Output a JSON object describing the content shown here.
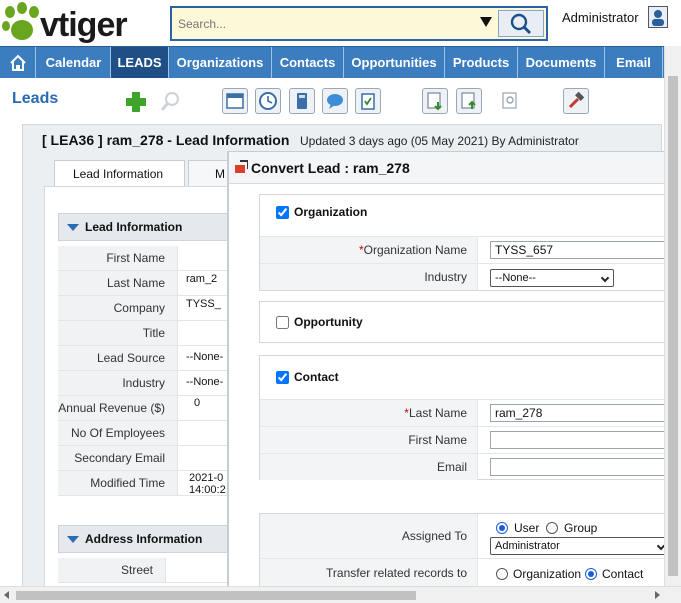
{
  "header": {
    "logo_text": "vtiger",
    "search_placeholder": "Search...",
    "user_name": "Administrator"
  },
  "nav": {
    "items": [
      {
        "label": "Calendar"
      },
      {
        "label": "LEADS"
      },
      {
        "label": "Organizations"
      },
      {
        "label": "Contacts"
      },
      {
        "label": "Opportunities"
      },
      {
        "label": "Products"
      },
      {
        "label": "Documents"
      },
      {
        "label": "Email"
      }
    ],
    "active_index": 1
  },
  "module": {
    "title": "Leads"
  },
  "record": {
    "title": "[ LEA36 ] ram_278 - Lead Information",
    "updated": "Updated 3 days ago (05 May 2021) By Administrator",
    "tabs": [
      {
        "label": "Lead Information"
      },
      {
        "label": "M"
      }
    ],
    "lead_block_title": "Lead Information",
    "address_block_title": "Address Information",
    "fields": [
      {
        "label": "First Name",
        "value": ""
      },
      {
        "label": "Last Name",
        "value": "ram_2"
      },
      {
        "label": "Company",
        "value": "TYSS_"
      },
      {
        "label": "Title",
        "value": ""
      },
      {
        "label": "Lead Source",
        "value": "--None-"
      },
      {
        "label": "Industry",
        "value": "--None-"
      },
      {
        "label": "Annual Revenue ($)",
        "value": "0"
      },
      {
        "label": "No Of Employees",
        "value": ""
      },
      {
        "label": "Secondary Email",
        "value": ""
      },
      {
        "label": "Modified Time",
        "value": "2021-0",
        "value2": "14:00:2"
      }
    ],
    "address_fields": [
      {
        "label": "Street",
        "value": ""
      }
    ]
  },
  "convert": {
    "title": "Convert Lead : ram_278",
    "organization": {
      "label": "Organization",
      "checked": true,
      "name_label": "Organization Name",
      "name_value": "TYSS_657",
      "industry_label": "Industry",
      "industry_value": "--None--"
    },
    "opportunity": {
      "label": "Opportunity",
      "checked": false
    },
    "contact": {
      "label": "Contact",
      "checked": true,
      "last_name_label": "Last Name",
      "last_name_value": "ram_278",
      "first_name_label": "First Name",
      "first_name_value": "",
      "email_label": "Email",
      "email_value": ""
    },
    "assigned": {
      "label": "Assigned To",
      "user_label": "User",
      "group_label": "Group",
      "selected": "User",
      "owner_value": "Administrator"
    },
    "transfer": {
      "label": "Transfer related records to",
      "org_label": "Organization",
      "contact_label": "Contact",
      "selected": "Contact"
    }
  },
  "colors": {
    "nav_bg": "#3c7dc0",
    "nav_active": "#1f4f86",
    "accent": "#2a6bb3",
    "required": "#cc0000"
  }
}
